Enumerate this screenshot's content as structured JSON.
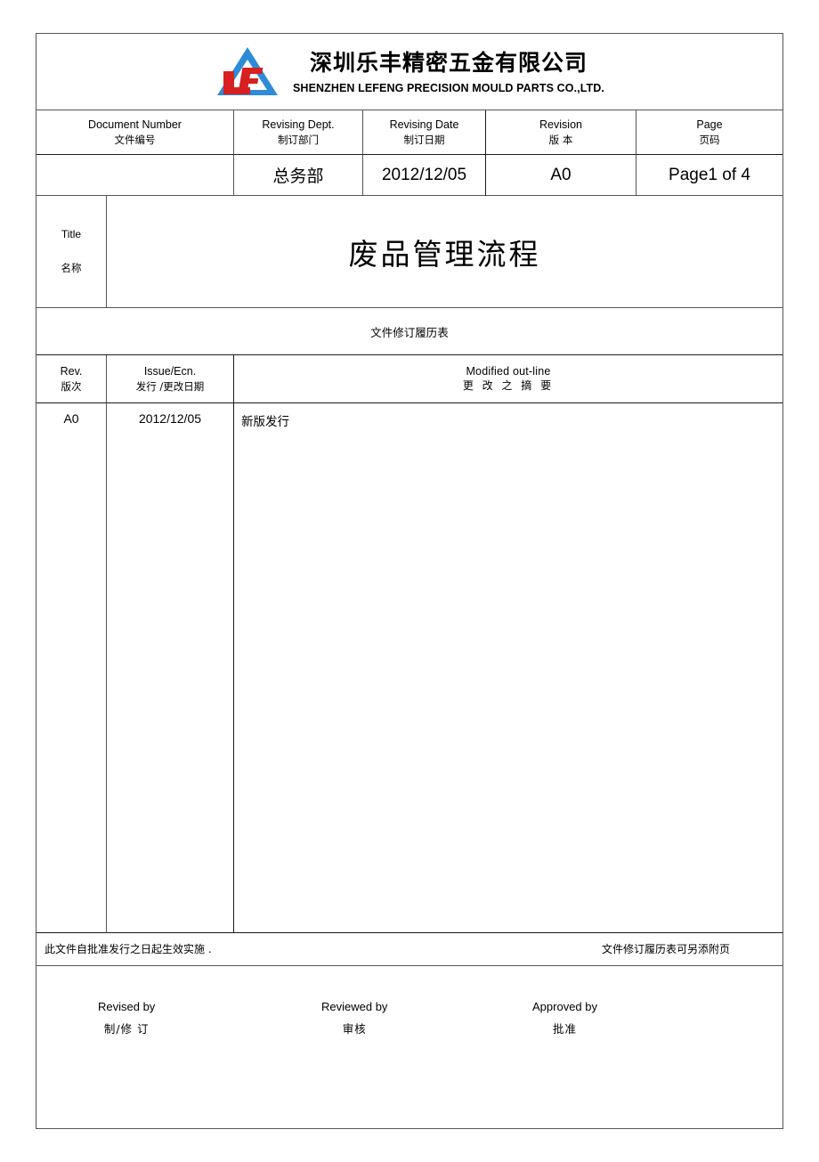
{
  "letterhead": {
    "logo_icon": "lefeng-triangle-logo",
    "company_cn": "深圳乐丰精密五金有限公司",
    "company_en": "SHENZHEN  LEFENG PRECISION MOULD  PARTS CO.,LTD.",
    "logo_colors": {
      "triangle": "#2E8BD8",
      "letters": "#D82020"
    }
  },
  "doc_header": {
    "columns": [
      {
        "en": "Document Number",
        "cn": "文件编号",
        "value": ""
      },
      {
        "en": "Revising Dept.",
        "cn": "制订部门",
        "value": "总务部"
      },
      {
        "en": "Revising Date",
        "cn": "制订日期",
        "value": "2012/12/05"
      },
      {
        "en": "Revision",
        "cn": "版  本",
        "value": "A0"
      },
      {
        "en": "Page",
        "cn": "页码",
        "value": "Page1 of 4"
      }
    ]
  },
  "title_band": {
    "label_en": "Title",
    "label_cn": "名称",
    "title": "废品管理流程"
  },
  "revision_history": {
    "caption": "文件修订履历表",
    "headers": [
      {
        "en": "Rev.",
        "cn": "版次"
      },
      {
        "en": "Issue/Ecn.",
        "cn": "发行 /更改日期"
      },
      {
        "en": "Modified    out-line",
        "cn": "更  改  之  摘  要"
      }
    ],
    "rows": [
      {
        "rev": "A0",
        "date": "2012/12/05",
        "outline": "新版发行"
      }
    ]
  },
  "footnote": {
    "left": "此文件自批准发行之日起生效实施    .",
    "right": "文件修订履历表可另添附页"
  },
  "signatures": [
    {
      "en": "Revised by",
      "cn": "制/修 订"
    },
    {
      "en": "Reviewed by",
      "cn": "审核"
    },
    {
      "en": "Approved by",
      "cn": "批准"
    }
  ]
}
